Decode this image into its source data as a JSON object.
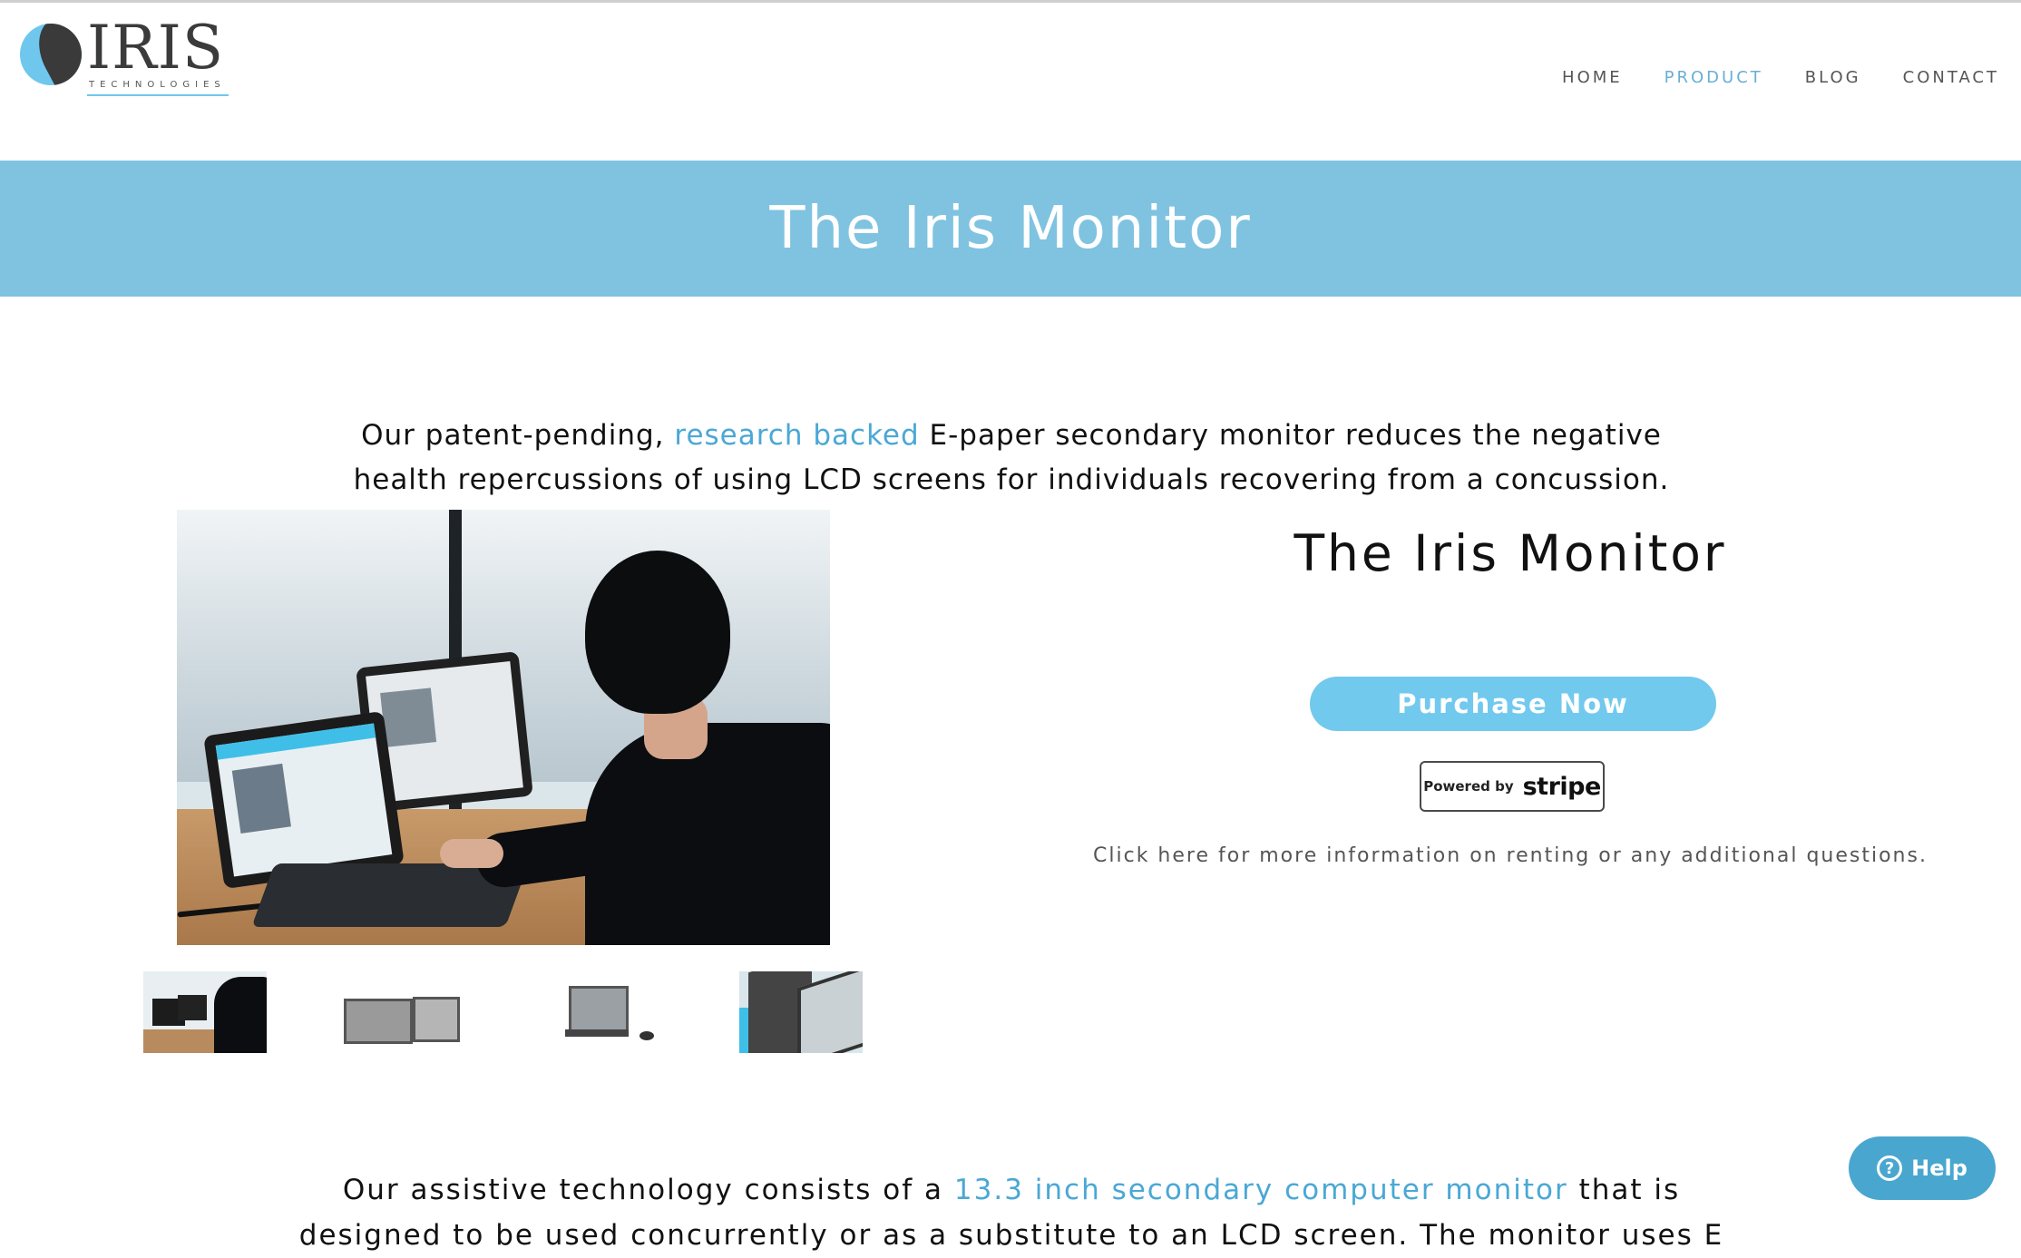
{
  "logo": {
    "word": "IRIS",
    "tagline": "TECHNOLOGIES",
    "icon": "iris-logo-icon"
  },
  "nav": {
    "items": [
      {
        "label": "HOME",
        "active": false
      },
      {
        "label": "PRODUCT",
        "active": true
      },
      {
        "label": "BLOG",
        "active": false
      },
      {
        "label": "CONTACT",
        "active": false
      }
    ]
  },
  "banner": {
    "title": "The Iris Monitor"
  },
  "intro": {
    "before": "Our patent-pending, ",
    "link": "research backed",
    "after": " E-paper secondary monitor reduces the negative health repercussions of using LCD screens for individuals recovering from a concussion."
  },
  "product": {
    "title": "The Iris Monitor",
    "purchase_label": "Purchase Now",
    "stripe_powered": "Powered by",
    "stripe_word": "stripe",
    "info": "Click here for more information on renting or any additional questions."
  },
  "bottom": {
    "before": "Our assistive technology consists of a ",
    "link": "13.3 inch secondary computer monitor",
    "after": " that is designed to be used concurrently or as a substitute to an LCD screen. The monitor uses E"
  },
  "help": {
    "label": "Help",
    "icon": "question-icon"
  },
  "colors": {
    "accent": "#7fc3e1",
    "link": "#4aa8d5",
    "button": "#72c9ee",
    "help": "#49a6cf"
  }
}
